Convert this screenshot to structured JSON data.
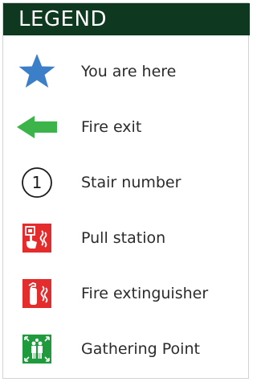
{
  "legend": {
    "title": "LEGEND",
    "items": [
      {
        "icon": "star-icon",
        "label": "You are here",
        "color": "#3b7fc9"
      },
      {
        "icon": "arrow-left-icon",
        "label": "Fire exit",
        "color": "#3cb44a"
      },
      {
        "icon": "circled-number-icon",
        "number": "1",
        "label": "Stair number",
        "color": "#1a1a1a"
      },
      {
        "icon": "pull-station-icon",
        "label": "Pull station",
        "color": "#e42c2c"
      },
      {
        "icon": "fire-extinguisher-icon",
        "label": "Fire extinguisher",
        "color": "#e42c2c"
      },
      {
        "icon": "gathering-point-icon",
        "label": "Gathering Point",
        "color": "#1f9a3c"
      }
    ]
  },
  "colors": {
    "header_background": "#0f3820",
    "header_text": "#ffffff",
    "border": "#d3d3d3"
  }
}
